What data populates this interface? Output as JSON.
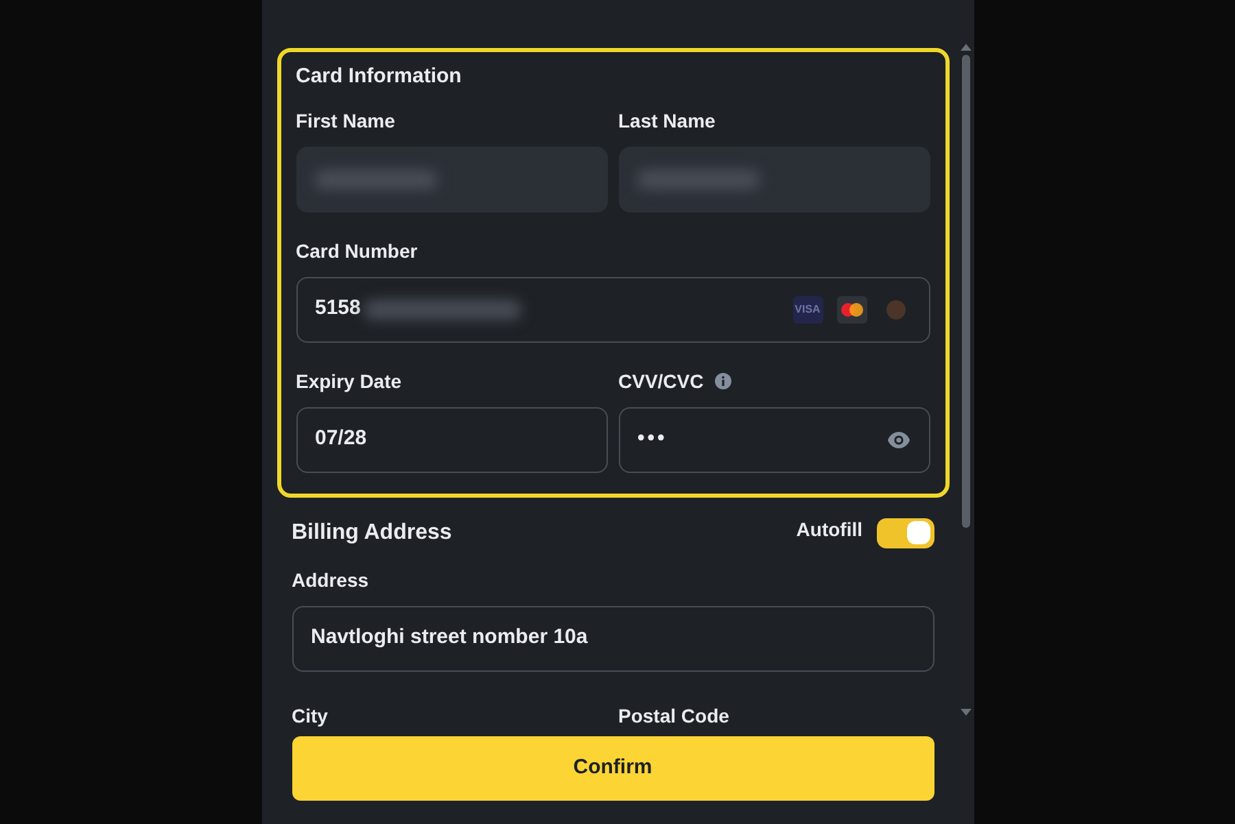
{
  "card_information": {
    "title": "Card Information",
    "highlighted": true,
    "first_name": {
      "label": "First Name",
      "blurred": true
    },
    "last_name": {
      "label": "Last Name",
      "blurred": true
    },
    "card_number": {
      "label": "Card Number",
      "value": "5158",
      "blurred": true,
      "brands": [
        {
          "kind": "visa",
          "text": "VISA"
        },
        {
          "kind": "mastercard"
        },
        {
          "kind": "other"
        }
      ]
    },
    "expiry_date": {
      "label": "Expiry Date",
      "value": "07/28"
    },
    "cvv": {
      "label": "CVV/CVC",
      "value": "•••"
    }
  },
  "billing_address": {
    "title": "Billing Address",
    "autofill": {
      "label": "Autofill",
      "on": true
    },
    "address": {
      "label": "Address",
      "value": "Navtloghi street nomber 10a"
    },
    "city": {
      "label": "City"
    },
    "postal_code": {
      "label": "Postal Code"
    }
  },
  "confirm_button": "Confirm"
}
